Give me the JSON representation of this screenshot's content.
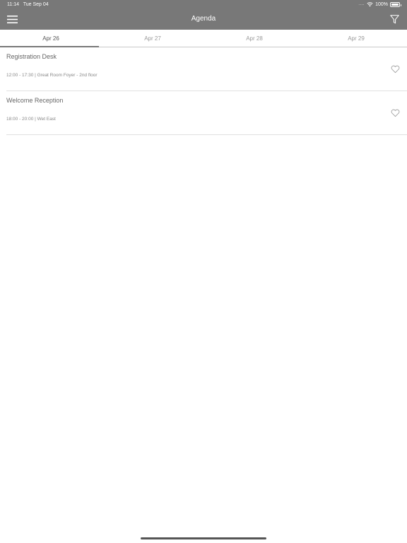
{
  "status": {
    "time": "11:14",
    "date": "Tue Sep 04",
    "signal": "....",
    "battery": "100%"
  },
  "nav": {
    "title": "Agenda"
  },
  "tabs": [
    {
      "label": "Apr 26",
      "active": true
    },
    {
      "label": "Apr 27",
      "active": false
    },
    {
      "label": "Apr 28",
      "active": false
    },
    {
      "label": "Apr 29",
      "active": false
    }
  ],
  "sessions": [
    {
      "name": "Registration Desk",
      "meta": "12:00 - 17:30 | Great Room Foyer - 2nd floor"
    },
    {
      "name": "Welcome Reception",
      "meta": "18:00 - 20:00 | Wet East"
    }
  ],
  "icons": {
    "menu": "hamburger-icon",
    "filter": "filter-icon",
    "favorite": "heart-outline-icon"
  },
  "colors": {
    "nav_bg": "#787878"
  }
}
